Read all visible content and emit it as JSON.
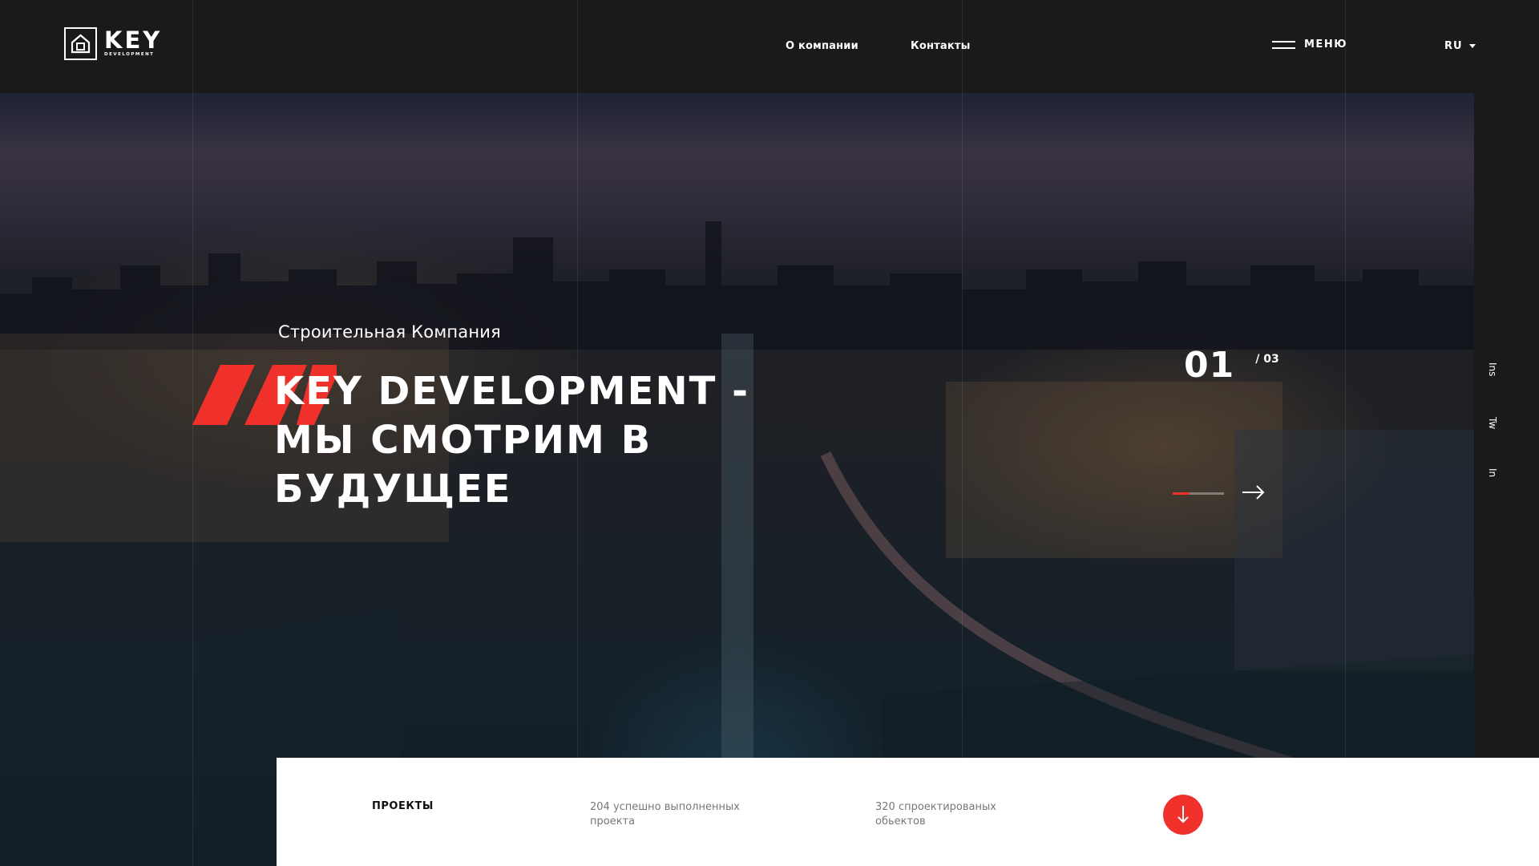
{
  "brand": {
    "name": "KEY",
    "tagline": "DEVELOPMENT"
  },
  "nav": {
    "links": [
      "О компании",
      "Контакты"
    ],
    "menu_label": "МЕНЮ",
    "language": "RU"
  },
  "hero": {
    "subtitle": "Строительная Компания",
    "title_lines": [
      "KEY DEVELOPMENT -",
      "МЫ СМОТРИМ В",
      "БУДУЩЕЕ"
    ],
    "slide_current": "01",
    "slide_total": "/ 03",
    "slide_progress": 0.33
  },
  "social": [
    "Ins",
    "Tw",
    "In"
  ],
  "info_bar": {
    "title": "ПРОЕКТЫ",
    "stats": [
      "204 успешно выполненных проекта",
      "320 спроектированых обьектов"
    ]
  },
  "colors": {
    "accent": "#f0302a",
    "header_bg": "#1a1a1a",
    "info_bg": "#ffffff"
  },
  "icons": {
    "logo": "house-icon",
    "menu": "hamburger-icon",
    "lang": "caret-down-icon",
    "next": "arrow-right-icon",
    "scroll": "arrow-down-icon"
  }
}
